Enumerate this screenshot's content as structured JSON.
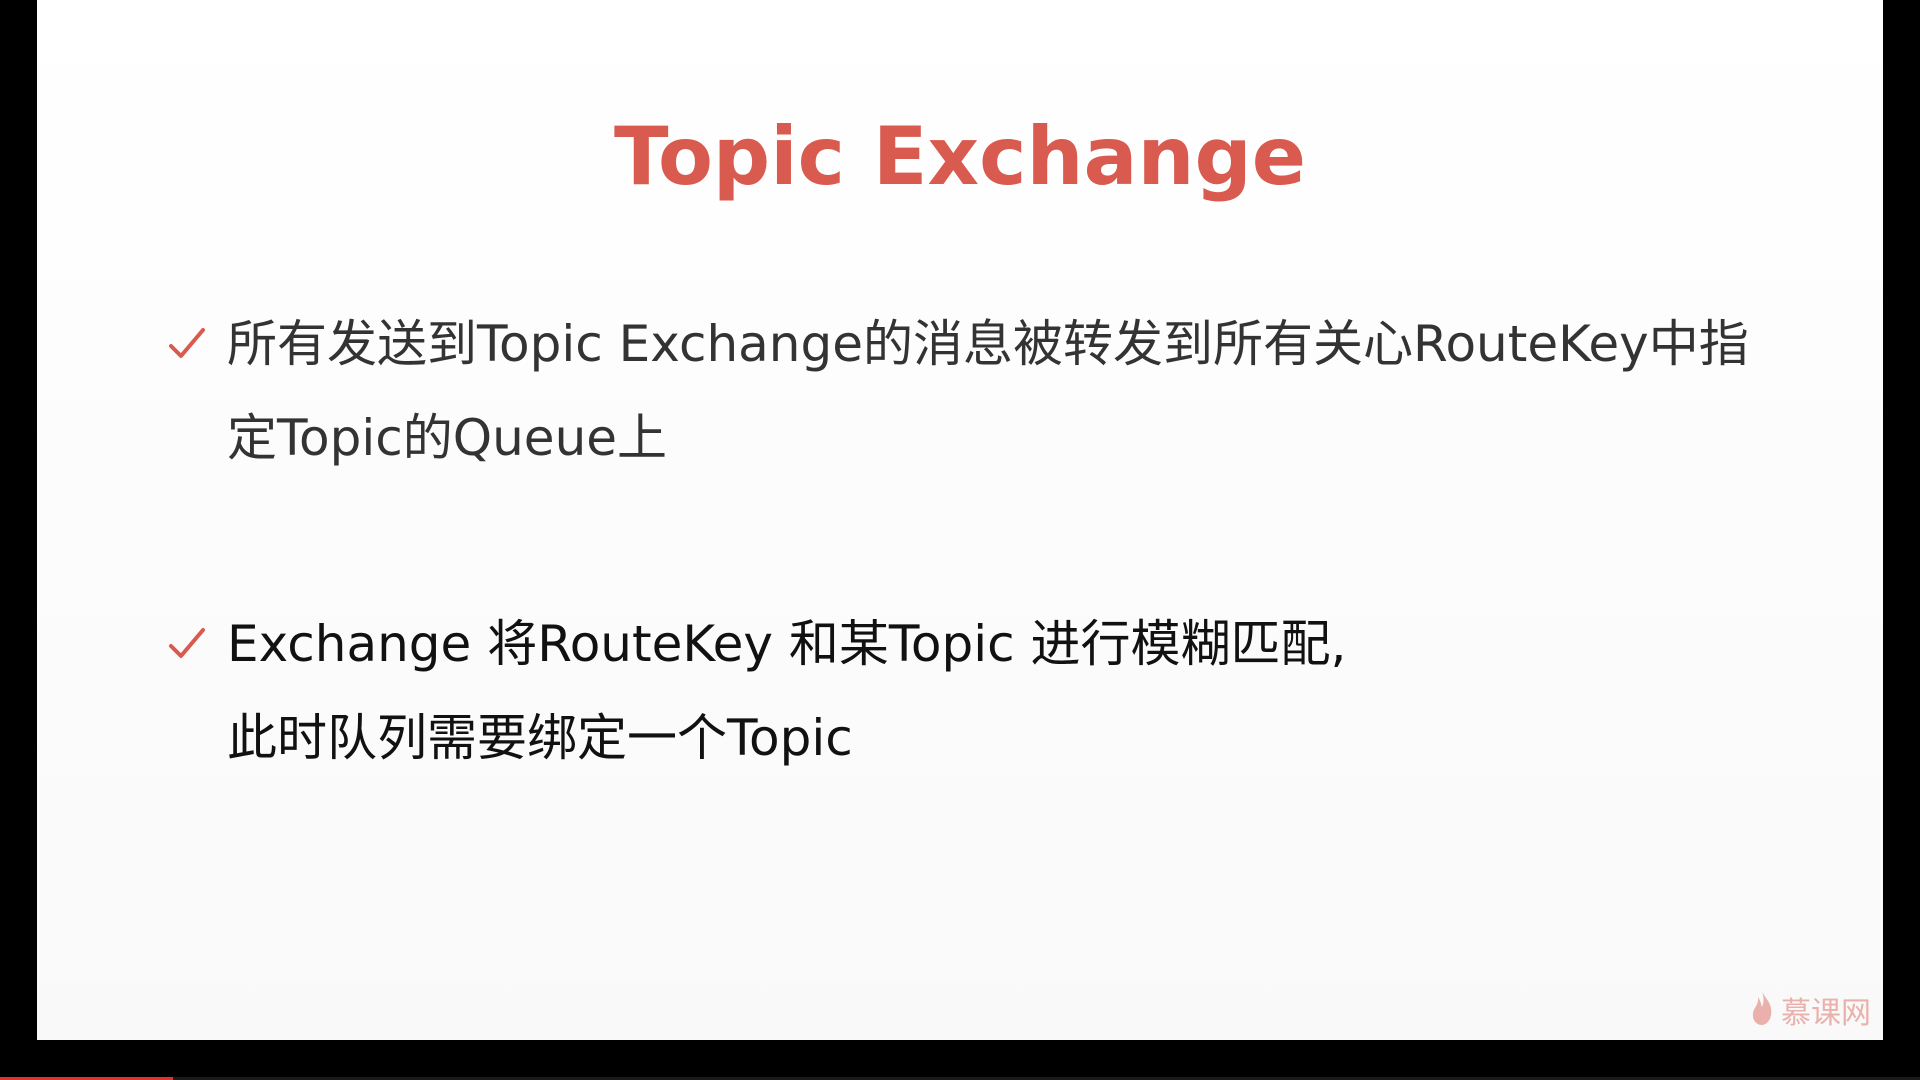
{
  "slide": {
    "title": "Topic Exchange",
    "bullets": [
      {
        "lines": [
          "所有发送到Topic Exchange的消息被转发到所有关心RouteKey中指",
          "定Topic的Queue上"
        ]
      },
      {
        "lines": [
          "Exchange 将RouteKey 和某Topic 进行模糊匹配,",
          "此时队列需要绑定一个Topic"
        ]
      }
    ]
  },
  "watermark": {
    "text": "慕课网",
    "icon": "flame-icon"
  },
  "video": {
    "progress": 0.09
  },
  "colors": {
    "accent": "#d95a4e",
    "text": "#333333",
    "background": "#ffffff",
    "letterbox": "#000000",
    "progress": "#e0322b"
  }
}
